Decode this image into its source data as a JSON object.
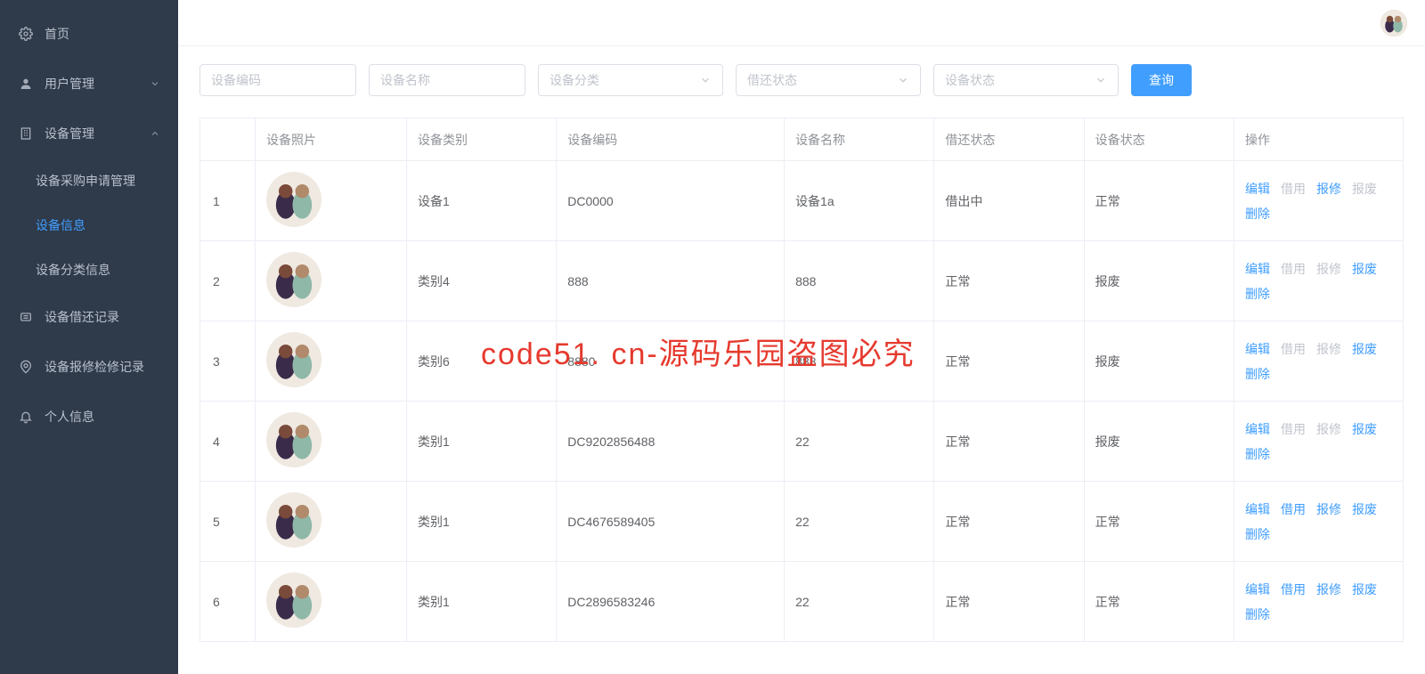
{
  "sidebar": {
    "items": [
      {
        "label": "首页",
        "icon": "gear"
      },
      {
        "label": "用户管理",
        "icon": "user",
        "arrow": "down"
      },
      {
        "label": "设备管理",
        "icon": "building",
        "arrow": "up",
        "children": [
          {
            "label": "设备采购申请管理"
          },
          {
            "label": "设备信息",
            "active": true
          },
          {
            "label": "设备分类信息"
          }
        ]
      },
      {
        "label": "设备借还记录",
        "icon": "swap"
      },
      {
        "label": "设备报修检修记录",
        "icon": "marker"
      },
      {
        "label": "个人信息",
        "icon": "bell"
      }
    ]
  },
  "filters": {
    "code_placeholder": "设备编码",
    "name_placeholder": "设备名称",
    "category_placeholder": "设备分类",
    "borrow_placeholder": "借还状态",
    "status_placeholder": "设备状态",
    "search_label": "查询"
  },
  "table": {
    "headers": [
      "",
      "设备照片",
      "设备类别",
      "设备编码",
      "设备名称",
      "借还状态",
      "设备状态",
      "操作"
    ],
    "ops": {
      "edit": "编辑",
      "borrow": "借用",
      "repair": "报修",
      "scrap": "报废",
      "delete": "删除"
    },
    "rows": [
      {
        "idx": "1",
        "category": "设备1",
        "code": "DC0000",
        "name": "设备1a",
        "borrow": "借出中",
        "status": "正常",
        "ops_state": {
          "borrow": "disabled",
          "scrap": "disabled"
        }
      },
      {
        "idx": "2",
        "category": "类别4",
        "code": "888",
        "name": "888",
        "borrow": "正常",
        "status": "报废",
        "ops_state": {
          "borrow": "disabled",
          "repair": "disabled"
        }
      },
      {
        "idx": "3",
        "category": "类别6",
        "code": "8880",
        "name": "888",
        "borrow": "正常",
        "status": "报废",
        "ops_state": {
          "borrow": "disabled",
          "repair": "disabled"
        }
      },
      {
        "idx": "4",
        "category": "类别1",
        "code": "DC9202856488",
        "name": "22",
        "borrow": "正常",
        "status": "报废",
        "ops_state": {
          "borrow": "disabled",
          "repair": "disabled"
        }
      },
      {
        "idx": "5",
        "category": "类别1",
        "code": "DC4676589405",
        "name": "22",
        "borrow": "正常",
        "status": "正常",
        "ops_state": {}
      },
      {
        "idx": "6",
        "category": "类别1",
        "code": "DC2896583246",
        "name": "22",
        "borrow": "正常",
        "status": "正常",
        "ops_state": {}
      }
    ]
  },
  "watermark": "code51. cn-源码乐园盗图必究"
}
